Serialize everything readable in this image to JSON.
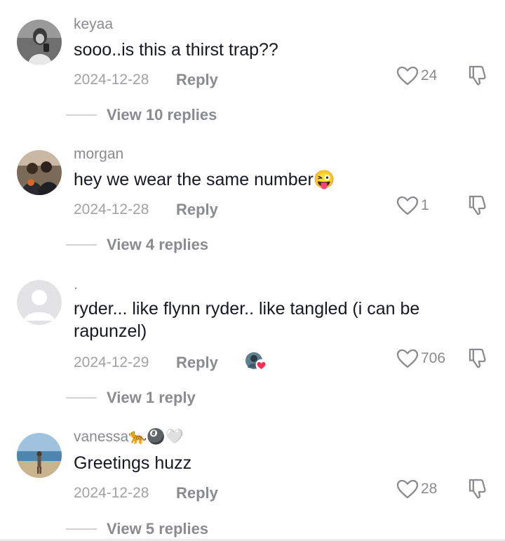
{
  "comments": [
    {
      "username": "keyaa",
      "text": "sooo..is this a thirst trap??",
      "date": "2024-12-28",
      "reply_label": "Reply",
      "likes": "24",
      "view_replies": "View 10 replies"
    },
    {
      "username": "morgan",
      "text": "hey we wear the same number😜",
      "date": "2024-12-28",
      "reply_label": "Reply",
      "likes": "1",
      "view_replies": "View 4 replies"
    },
    {
      "username": ".",
      "text": "ryder... like flynn ryder.. like tangled (i can be rapunzel)",
      "date": "2024-12-29",
      "reply_label": "Reply",
      "likes": "706",
      "view_replies": "View 1 reply"
    },
    {
      "username": "vanessa🐆🎱🤍",
      "text": "Greetings huzz",
      "date": "2024-12-28",
      "reply_label": "Reply",
      "likes": "28",
      "view_replies": "View 5 replies"
    }
  ],
  "icons": {
    "like": "heart-outline-icon",
    "dislike": "thumbs-down-icon",
    "creator_liked": "creator-liked-badge-icon"
  },
  "colors": {
    "text_primary": "#161823",
    "text_secondary": "#8a8b91",
    "heart_badge": "#fe2c55"
  }
}
